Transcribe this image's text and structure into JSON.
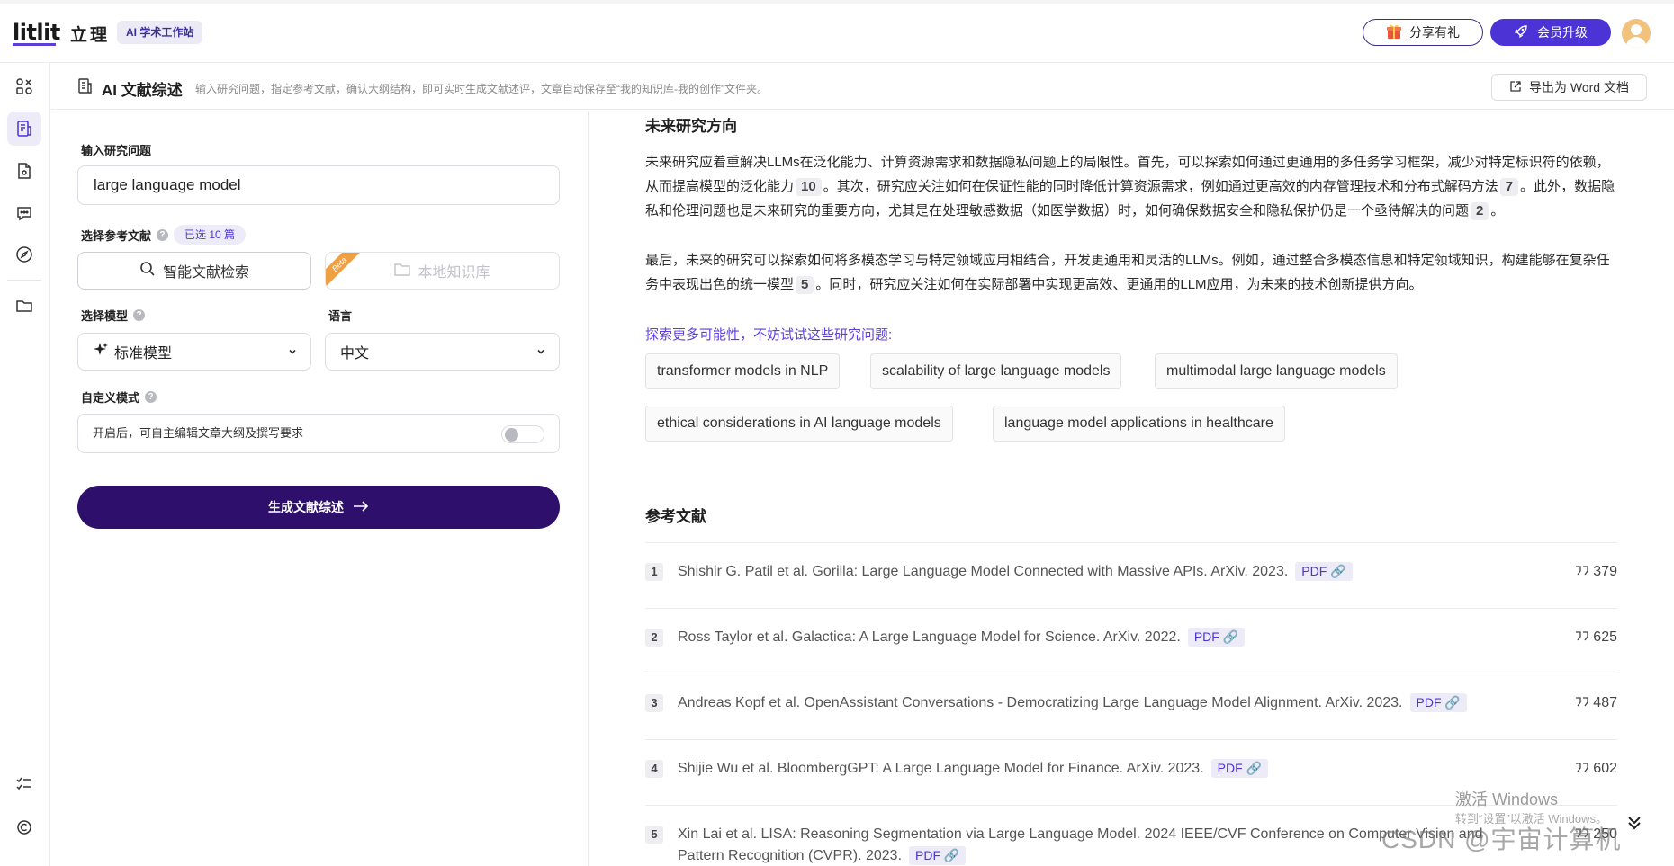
{
  "brand": {
    "logo": "litlit",
    "name_cn": "立理",
    "badge": "AI 学术工作站"
  },
  "topbar": {
    "share_label": "分享有礼",
    "vip_label": "会员升级"
  },
  "subheader": {
    "title": "AI 文献综述",
    "description": "输入研究问题，指定参考文献，确认大纲结构，即可实时生成文献述评，文章自动保存至“我的知识库-我的创作”文件夹。",
    "export_label": "导出为 Word 文档"
  },
  "form": {
    "question_label": "输入研究问题",
    "question_value": "large language model",
    "refs_label": "选择参考文献",
    "refs_selected": "已选 10 篇",
    "smart_search": "智能文献检索",
    "local_library": "本地知识库",
    "beta": "Beta",
    "model_label": "选择模型",
    "model_value": "标准模型",
    "language_label": "语言",
    "language_value": "中文",
    "custom_label": "自定义模式",
    "custom_desc": "开启后，可自主编辑文章大纲及撰写要求",
    "generate_label": "生成文献综述"
  },
  "content": {
    "future_heading": "未来研究方向",
    "para1_a": "未来研究应着重解决LLMs在泛化能力、计算资源需求和数据隐私问题上的局限性。首先，可以探索如何通过更通用的多任务学习框架，减少对特定标识符的依赖，从而提高模型的泛化能力",
    "para1_c1": "10",
    "para1_b": "。其次，研究应关注如何在保证性能的同时降低计算资源需求，例如通过更高效的内存管理技术和分布式解码方法",
    "para1_c2": "7",
    "para1_c": "。此外，数据隐私和伦理问题也是未来研究的重要方向，尤其是在处理敏感数据（如医学数据）时，如何确保数据安全和隐私保护仍是一个亟待解决的问题",
    "para1_c3": "2",
    "para1_d": "。",
    "para2_a": "最后，未来的研究可以探索如何将多模态学习与特定领域应用相结合，开发更通用和灵活的LLMs。例如，通过整合多模态信息和特定领域知识，构建能够在复杂任务中表现出色的统一模型",
    "para2_c1": "5",
    "para2_b": "。同时，研究应关注如何在实际部署中实现更高效、更通用的LLM应用，为未来的技术创新提供方向。",
    "explore_label": "探索更多可能性，不妨试试这些研究问题:",
    "suggestions": [
      "transformer models in NLP",
      "scalability of large language models",
      "multimodal large language models",
      "ethical considerations in AI language models",
      "language model applications in healthcare"
    ],
    "refs_heading": "参考文献",
    "pdf_label": "PDF",
    "references": [
      {
        "num": "1",
        "text": "Shishir G. Patil et al. Gorilla: Large Language Model Connected with Massive APIs. ArXiv. 2023.",
        "cites": "379"
      },
      {
        "num": "2",
        "text": "Ross Taylor et al. Galactica: A Large Language Model for Science. ArXiv. 2022.",
        "cites": "625"
      },
      {
        "num": "3",
        "text": "Andreas Kopf et al. OpenAssistant Conversations - Democratizing Large Language Model Alignment. ArXiv. 2023.",
        "cites": "487"
      },
      {
        "num": "4",
        "text": "Shijie Wu et al. BloombergGPT: A Large Language Model for Finance. ArXiv. 2023.",
        "cites": "602"
      },
      {
        "num": "5",
        "text": "Xin Lai et al. LISA: Reasoning Segmentation via Large Language Model. 2024 IEEE/CVF Conference on Computer Vision and Pattern Recognition (CVPR). 2023.",
        "cites": "250"
      }
    ]
  },
  "overlay": {
    "win_line1": "激活 Windows",
    "win_line2": "转到“设置”以激活 Windows。",
    "csdn": "CSDN @宇宙计算机"
  },
  "colors": {
    "accent": "#4b33d6",
    "generate_bg": "#2e0f6b",
    "link": "#5b3fd6"
  }
}
